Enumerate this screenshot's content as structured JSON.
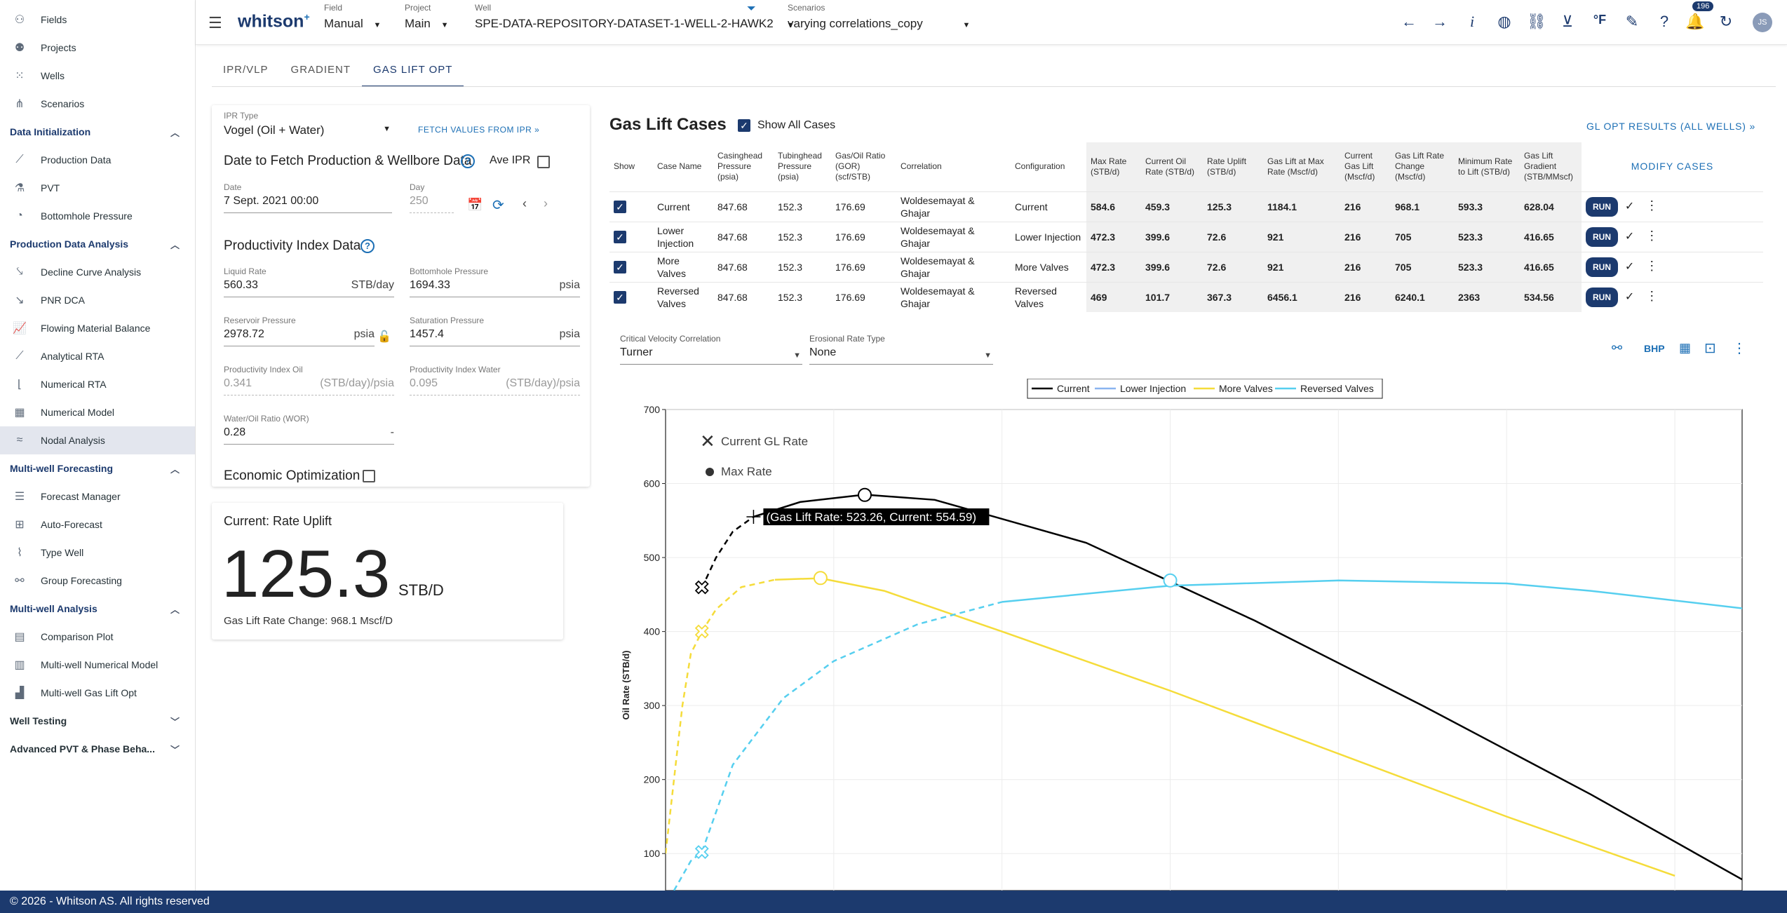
{
  "sidebar": {
    "top_items": [
      {
        "label": "Fields",
        "icon": "fields-icon"
      },
      {
        "label": "Projects",
        "icon": "projects-icon"
      },
      {
        "label": "Wells",
        "icon": "wells-icon"
      },
      {
        "label": "Scenarios",
        "icon": "scenarios-icon"
      }
    ],
    "sections": [
      {
        "title": "Data Initialization",
        "expanded": true,
        "items": [
          "Production Data",
          "PVT",
          "Bottomhole Pressure"
        ]
      },
      {
        "title": "Production Data Analysis",
        "expanded": true,
        "items": [
          "Decline Curve Analysis",
          "PNR DCA",
          "Flowing Material Balance",
          "Analytical RTA",
          "Numerical RTA",
          "Numerical Model",
          "Nodal Analysis"
        ]
      },
      {
        "title": "Multi-well Forecasting",
        "expanded": true,
        "items": [
          "Forecast Manager",
          "Auto-Forecast",
          "Type Well",
          "Group Forecasting"
        ]
      },
      {
        "title": "Multi-well Analysis",
        "expanded": true,
        "items": [
          "Comparison Plot",
          "Multi-well Numerical Model",
          "Multi-well Gas Lift Opt"
        ]
      },
      {
        "title": "Well Testing",
        "expanded": false,
        "items": []
      },
      {
        "title": "Advanced PVT & Phase Beha...",
        "expanded": false,
        "items": []
      }
    ],
    "active_item": "Nodal Analysis"
  },
  "topbar": {
    "logo": "whitson",
    "logo_sup": "+",
    "field_label": "Field",
    "field_value": "Manual",
    "project_label": "Project",
    "project_value": "Main",
    "well_label": "Well",
    "well_value": "SPE-DATA-REPOSITORY-DATASET-1-WELL-2-HAWK2",
    "scenarios_label": "Scenarios",
    "scenarios_value": "varying correlations_copy",
    "notifications": "196",
    "avatar": "JS",
    "unit_glyph": "°F"
  },
  "tabs": [
    "IPR/VLP",
    "GRADIENT",
    "GAS LIFT OPT"
  ],
  "active_tab": "GAS LIFT OPT",
  "ipr_panel": {
    "ipr_type_label": "IPR Type",
    "ipr_type_value": "Vogel (Oil + Water)",
    "fetch_label": "FETCH VALUES FROM IPR",
    "date_section_title": "Date to Fetch Production & Wellbore Data",
    "ave_ipr_label": "Ave IPR",
    "date_label": "Date",
    "date_value": "7 Sept. 2021 00:00",
    "day_label": "Day",
    "day_value": "250",
    "pi_title": "Productivity Index Data",
    "liquid_rate_label": "Liquid Rate",
    "liquid_rate_value": "560.33",
    "liquid_rate_unit": "STB/day",
    "bhp_label": "Bottomhole Pressure",
    "bhp_value": "1694.33",
    "bhp_unit": "psia",
    "res_p_label": "Reservoir Pressure",
    "res_p_value": "2978.72",
    "res_p_unit": "psia",
    "sat_p_label": "Saturation Pressure",
    "sat_p_value": "1457.4",
    "sat_p_unit": "psia",
    "pi_oil_label": "Productivity Index Oil",
    "pi_oil_value": "0.341",
    "pi_oil_unit": "(STB/day)/psia",
    "pi_water_label": "Productivity Index Water",
    "pi_water_value": "0.095",
    "pi_water_unit": "(STB/day)/psia",
    "wor_label": "Water/Oil Ratio (WOR)",
    "wor_value": "0.28",
    "wor_unit": "-",
    "econ_label": "Economic Optimization"
  },
  "uplift_card": {
    "title": "Current: Rate Uplift",
    "value": "125.3",
    "unit": "STB/D",
    "change": "Gas Lift Rate Change: 968.1 Mscf/D"
  },
  "cases": {
    "title": "Gas Lift Cases",
    "show_all_label": "Show All Cases",
    "gl_opt_link": "GL OPT RESULTS (ALL WELLS)",
    "modify_label": "MODIFY CASES",
    "run_label": "RUN",
    "columns": [
      "Show",
      "Case Name",
      "Casinghead Pressure (psia)",
      "Tubinghead Pressure (psia)",
      "Gas/Oil Ratio (GOR) (scf/STB)",
      "Correlation",
      "Configuration",
      "Max Rate (STB/d)",
      "Current Oil Rate (STB/d)",
      "Rate Uplift (STB/d)",
      "Gas Lift at Max Rate (Mscf/d)",
      "Current Gas Lift (Mscf/d)",
      "Gas Lift Rate Change (Mscf/d)",
      "Minimum Rate to Lift (STB/d)",
      "Gas Lift Gradient (STB/MMscf)"
    ],
    "rows": [
      [
        "Current",
        "847.68",
        "152.3",
        "176.69",
        "Woldesemayat & Ghajar",
        "Current",
        "584.6",
        "459.3",
        "125.3",
        "1184.1",
        "216",
        "968.1",
        "593.3",
        "628.04"
      ],
      [
        "Lower Injection",
        "847.68",
        "152.3",
        "176.69",
        "Woldesemayat & Ghajar",
        "Lower Injection",
        "472.3",
        "399.6",
        "72.6",
        "921",
        "216",
        "705",
        "523.3",
        "416.65"
      ],
      [
        "More Valves",
        "847.68",
        "152.3",
        "176.69",
        "Woldesemayat & Ghajar",
        "More Valves",
        "472.3",
        "399.6",
        "72.6",
        "921",
        "216",
        "705",
        "523.3",
        "416.65"
      ],
      [
        "Reversed Valves",
        "847.68",
        "152.3",
        "176.69",
        "Woldesemayat & Ghajar",
        "Reversed Valves",
        "469",
        "101.7",
        "367.3",
        "6456.1",
        "216",
        "6240.1",
        "2363",
        "534.56"
      ]
    ]
  },
  "chart_controls": {
    "cv_label": "Critical Velocity Correlation",
    "cv_value": "Turner",
    "er_label": "Erosional Rate Type",
    "er_value": "None",
    "bhp_button": "BHP"
  },
  "chart_data": {
    "type": "line",
    "ylabel": "Oil Rate (STB/d)",
    "ylim": [
      50,
      700
    ],
    "xlim": [
      0,
      6400
    ],
    "y_ticks": [
      100,
      200,
      300,
      400,
      500,
      600,
      700
    ],
    "legend": [
      "Current",
      "Lower Injection",
      "More Valves",
      "Reversed Valves"
    ],
    "legend_placement": "top-center",
    "grid": true,
    "marker_legend": [
      "Current GL Rate",
      "Max Rate"
    ],
    "tooltip": "(Gas Lift Rate: 523.26, Current: 554.59)",
    "colors": {
      "Current": "#000000",
      "Lower Injection": "#8ab4f0",
      "More Valves": "#f5dc3a",
      "Reversed Valves": "#56cfef"
    },
    "series": [
      {
        "name": "Current",
        "color": "#000000",
        "dashed": {
          "x": [
            216,
            300,
            400,
            523
          ],
          "y": [
            459,
            500,
            535,
            555
          ]
        },
        "solid": {
          "x": [
            523,
            800,
            1184,
            1600,
            2500,
            3500,
            4500,
            5500,
            6400
          ],
          "y": [
            555,
            575,
            585,
            578,
            520,
            415,
            300,
            180,
            65
          ]
        },
        "current_gl": {
          "x": 216,
          "y": 459.3
        },
        "max": {
          "x": 1184.1,
          "y": 584.6
        }
      },
      {
        "name": "More Valves",
        "color": "#f5dc3a",
        "dashed": {
          "x": [
            0,
            100,
            150,
            216,
            300,
            450,
            650
          ],
          "y": [
            100,
            300,
            370,
            400,
            430,
            460,
            470
          ]
        },
        "solid": {
          "x": [
            650,
            921,
            1300,
            2000,
            3000,
            4000,
            5000,
            6000
          ],
          "y": [
            470,
            472,
            455,
            400,
            320,
            235,
            150,
            70
          ]
        },
        "current_gl": {
          "x": 216,
          "y": 399.6
        },
        "max": {
          "x": 921,
          "y": 472.3
        }
      },
      {
        "name": "Reversed Valves",
        "color": "#56cfef",
        "dashed": {
          "x": [
            50,
            150,
            216,
            400,
            700,
            1000,
            1500,
            2000
          ],
          "y": [
            50,
            90,
            102,
            220,
            310,
            360,
            410,
            440
          ]
        },
        "solid": {
          "x": [
            2000,
            3000,
            4000,
            5000,
            5500,
            6456
          ],
          "y": [
            440,
            462,
            469,
            465,
            455,
            430
          ]
        },
        "current_gl": {
          "x": 216,
          "y": 101.7
        },
        "max": {
          "x": 3000,
          "y": 469
        }
      }
    ]
  },
  "footer": "© 2026 - Whitson AS. All rights reserved"
}
